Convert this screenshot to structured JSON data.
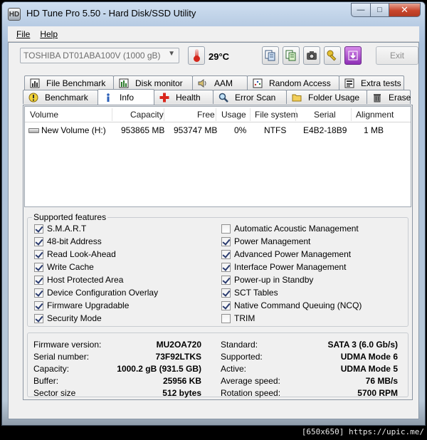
{
  "window": {
    "title": "HD Tune Pro 5.50 - Hard Disk/SSD Utility",
    "minimize": "—",
    "maximize": "□",
    "close": "✕"
  },
  "menu": {
    "file": "File",
    "help": "Help"
  },
  "toolbar": {
    "drive": "TOSHIBA DT01ABA100V (1000 gB)",
    "temperature": "29°C",
    "exit_label": "Exit",
    "icons": [
      "copy-icon",
      "copy-all-icon",
      "camera-icon",
      "options-key-icon",
      "down-arrow-icon"
    ]
  },
  "tabs": {
    "row1": [
      "File Benchmark",
      "Disk monitor",
      "AAM",
      "Random Access",
      "Extra tests"
    ],
    "row2": [
      "Benchmark",
      "Info",
      "Health",
      "Error Scan",
      "Folder Usage",
      "Erase"
    ],
    "active": "Info"
  },
  "volumes": {
    "columns": [
      "Volume",
      "Capacity",
      "Free",
      "Usage",
      "File system",
      "Serial",
      "Alignment"
    ],
    "rows": [
      [
        "New Volume (H:)",
        "953865 MB",
        "953747 MB",
        "0%",
        "NTFS",
        "E4B2-18B9",
        "1 MB"
      ]
    ]
  },
  "features": {
    "title": "Supported features",
    "left": [
      {
        "label": "S.M.A.R.T",
        "checked": true
      },
      {
        "label": "48-bit Address",
        "checked": true
      },
      {
        "label": "Read Look-Ahead",
        "checked": true
      },
      {
        "label": "Write Cache",
        "checked": true
      },
      {
        "label": "Host Protected Area",
        "checked": true
      },
      {
        "label": "Device Configuration Overlay",
        "checked": true
      },
      {
        "label": "Firmware Upgradable",
        "checked": true
      },
      {
        "label": "Security Mode",
        "checked": true
      }
    ],
    "right": [
      {
        "label": "Automatic Acoustic Management",
        "checked": false
      },
      {
        "label": "Power Management",
        "checked": true
      },
      {
        "label": "Advanced Power Management",
        "checked": true
      },
      {
        "label": "Interface Power Management",
        "checked": true
      },
      {
        "label": "Power-up in Standby",
        "checked": true
      },
      {
        "label": "SCT Tables",
        "checked": true
      },
      {
        "label": "Native Command Queuing (NCQ)",
        "checked": true
      },
      {
        "label": "TRIM",
        "checked": false
      }
    ]
  },
  "details": {
    "left": [
      {
        "key": "Firmware version:",
        "value": "MU2OA720"
      },
      {
        "key": "Serial number:",
        "value": "73F92LTKS"
      },
      {
        "key": "Capacity:",
        "value": "1000.2 gB (931.5 GB)"
      },
      {
        "key": "Buffer:",
        "value": "25956 KB"
      },
      {
        "key": "Sector size",
        "value": "512 bytes"
      }
    ],
    "right": [
      {
        "key": "Standard:",
        "value": "SATA 3 (6.0 Gb/s)"
      },
      {
        "key": "Supported:",
        "value": "UDMA Mode 6"
      },
      {
        "key": "Active:",
        "value": "UDMA Mode 5"
      },
      {
        "key": "Average speed:",
        "value": "76 MB/s"
      },
      {
        "key": "Rotation speed:",
        "value": "5700 RPM"
      }
    ]
  },
  "watermark": "[650x650] https://upic.me/",
  "colors": {
    "check": "#2a3b6e",
    "thermo_red": "#d3261b",
    "close_red": "#c8452c"
  }
}
